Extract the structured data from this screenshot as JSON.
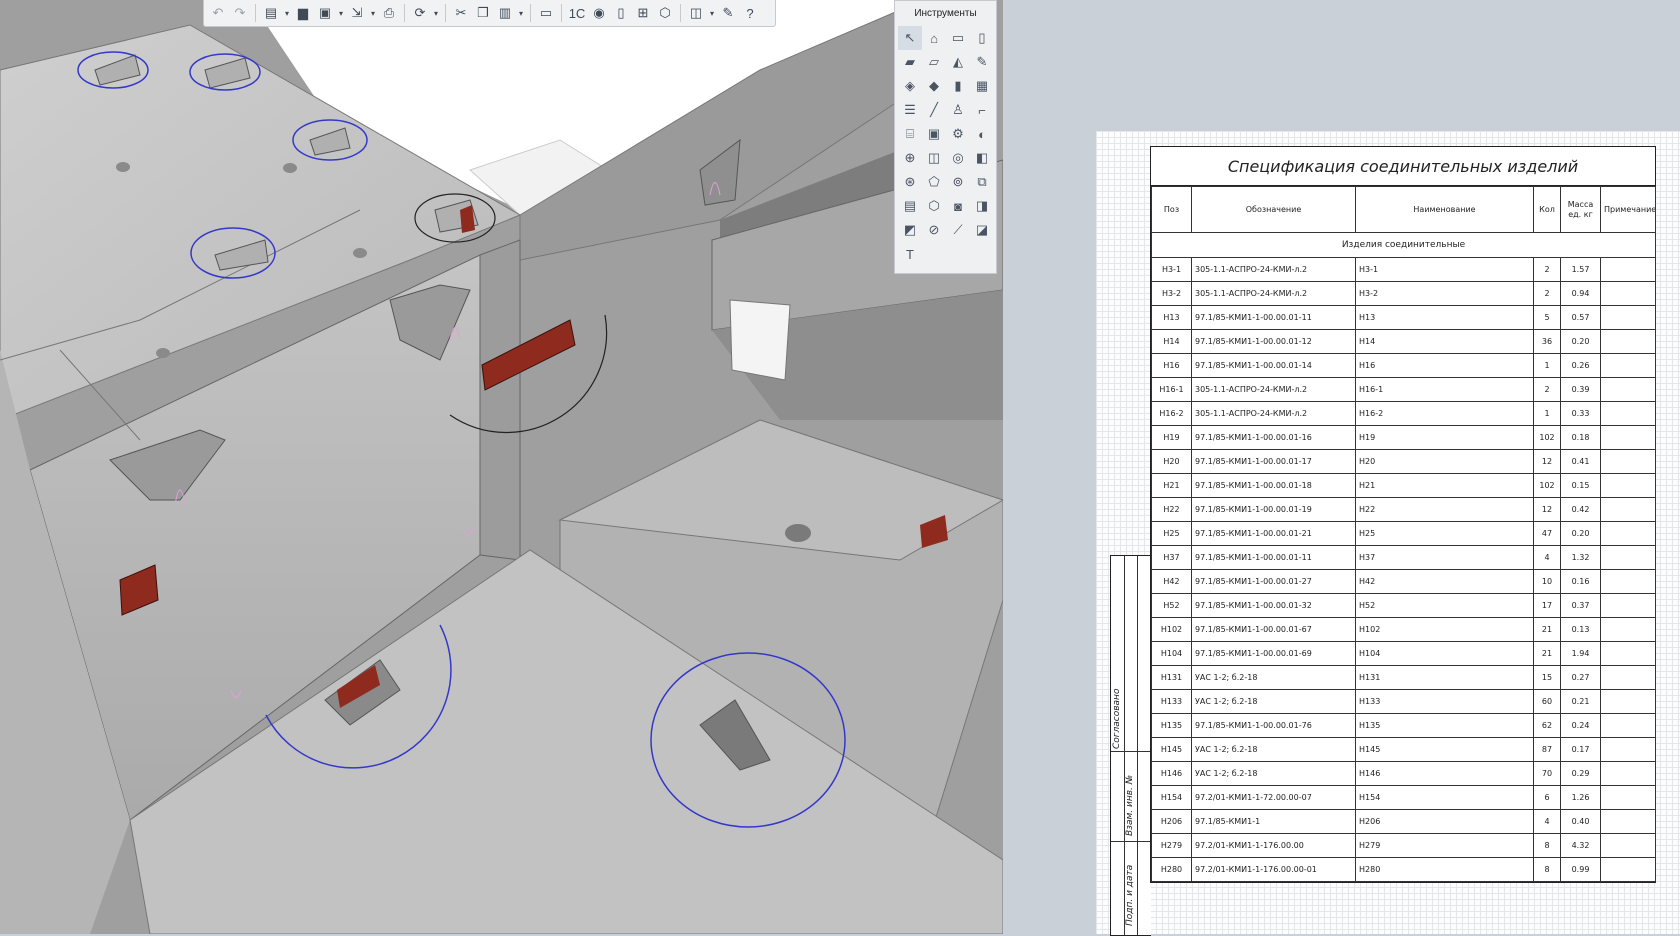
{
  "toolbar": {
    "items": [
      {
        "name": "undo-icon",
        "glyph": "↶",
        "dim": true
      },
      {
        "name": "redo-icon",
        "glyph": "↷",
        "dim": true
      },
      {
        "name": "new-document-icon",
        "glyph": "▤",
        "dd": true
      },
      {
        "name": "open-folder-icon",
        "glyph": "▆"
      },
      {
        "name": "save-icon",
        "glyph": "▣",
        "dd": true
      },
      {
        "name": "export-icon",
        "glyph": "⇲",
        "dd": true
      },
      {
        "name": "print-icon",
        "glyph": "⎙"
      },
      {
        "name": "view-rotate-icon",
        "glyph": "⟳",
        "dd": true
      },
      {
        "name": "cut-icon",
        "glyph": "✂"
      },
      {
        "name": "copy-icon",
        "glyph": "❐"
      },
      {
        "name": "paste-icon",
        "glyph": "▥",
        "dd": true
      },
      {
        "name": "format-brush-icon",
        "glyph": "▭"
      },
      {
        "name": "1c-icon",
        "glyph": "1С"
      },
      {
        "name": "render-icon",
        "glyph": "◉"
      },
      {
        "name": "properties-icon",
        "glyph": "▯"
      },
      {
        "name": "structure-tree-icon",
        "glyph": "⊞"
      },
      {
        "name": "model-3d-icon",
        "glyph": "⬡"
      },
      {
        "name": "layers-icon",
        "glyph": "◫",
        "dd": true
      },
      {
        "name": "settings-wrench-icon",
        "glyph": "✎"
      },
      {
        "name": "help-icon",
        "glyph": "?"
      }
    ]
  },
  "tools": {
    "title": "Инструменты",
    "items": [
      {
        "name": "select-arrow-icon",
        "glyph": "↖",
        "active": true
      },
      {
        "name": "wall-tool-icon",
        "glyph": "⌂"
      },
      {
        "name": "rectangle-tool-icon",
        "glyph": "▭"
      },
      {
        "name": "column-tool-icon",
        "glyph": "▯"
      },
      {
        "name": "slab-tool-icon",
        "glyph": "▰"
      },
      {
        "name": "beam-tool-icon",
        "glyph": "▱"
      },
      {
        "name": "roof-tool-icon",
        "glyph": "◭"
      },
      {
        "name": "pencil-tool-icon",
        "glyph": "✎"
      },
      {
        "name": "panel-tool-icon",
        "glyph": "◈"
      },
      {
        "name": "plate-tool-icon",
        "glyph": "◆"
      },
      {
        "name": "door-tool-icon",
        "glyph": "▮"
      },
      {
        "name": "window-tool-icon",
        "glyph": "▦"
      },
      {
        "name": "railing-tool-icon",
        "glyph": "☰"
      },
      {
        "name": "line-tool-icon",
        "glyph": "╱"
      },
      {
        "name": "fixture-tool-icon",
        "glyph": "♙"
      },
      {
        "name": "pipe-tool-icon",
        "glyph": "⌐"
      },
      {
        "name": "stair-tool-icon",
        "glyph": "⌸"
      },
      {
        "name": "opening-tool-icon",
        "glyph": "▣"
      },
      {
        "name": "equipment-tool-icon",
        "glyph": "⚙"
      },
      {
        "name": "duct-tool-icon",
        "glyph": "◐"
      },
      {
        "name": "mesh-tool-icon",
        "glyph": "⊕"
      },
      {
        "name": "room-tool-icon",
        "glyph": "◫"
      },
      {
        "name": "surface-tool-icon",
        "glyph": "◎"
      },
      {
        "name": "object-tool-icon",
        "glyph": "◧"
      },
      {
        "name": "assembly-tool-icon",
        "glyph": "⊛"
      },
      {
        "name": "shell-tool-icon",
        "glyph": "⬠"
      },
      {
        "name": "tank-tool-icon",
        "glyph": "⊚"
      },
      {
        "name": "cube-tool-icon",
        "glyph": "⧉"
      },
      {
        "name": "cabinet-tool-icon",
        "glyph": "▤"
      },
      {
        "name": "solid-tool-icon",
        "glyph": "⬡"
      },
      {
        "name": "camera-tool-icon",
        "glyph": "◙"
      },
      {
        "name": "zone-tool-icon",
        "glyph": "◨"
      },
      {
        "name": "detail-tool-icon",
        "glyph": "◩"
      },
      {
        "name": "section-tool-icon",
        "glyph": "⊘"
      },
      {
        "name": "dimension-tool-icon",
        "glyph": "⟋"
      },
      {
        "name": "hatch-tool-icon",
        "glyph": "◪"
      },
      {
        "name": "text-tool-icon",
        "glyph": "T"
      }
    ]
  },
  "spec": {
    "title": "Спецификация соединительных изделий",
    "headers": {
      "pos": "Поз",
      "designation": "Обозначение",
      "name": "Наименование",
      "qty": "Кол",
      "mass": "Масса ед. кг",
      "note": "Примечание"
    },
    "group": "Изделия соединительные",
    "rows": [
      [
        "Н3-1",
        "305-1.1-АСПРО-24-КМИ-л.2",
        "Н3-1",
        "2",
        "1.57",
        ""
      ],
      [
        "Н3-2",
        "305-1.1-АСПРО-24-КМИ-л.2",
        "Н3-2",
        "2",
        "0.94",
        ""
      ],
      [
        "Н13",
        "97.1/85-КМИ1-1-00.00.01-11",
        "Н13",
        "5",
        "0.57",
        ""
      ],
      [
        "Н14",
        "97.1/85-КМИ1-1-00.00.01-12",
        "Н14",
        "36",
        "0.20",
        ""
      ],
      [
        "Н16",
        "97.1/85-КМИ1-1-00.00.01-14",
        "Н16",
        "1",
        "0.26",
        ""
      ],
      [
        "Н16-1",
        "305-1.1-АСПРО-24-КМИ-л.2",
        "Н16-1",
        "2",
        "0.39",
        ""
      ],
      [
        "Н16-2",
        "305-1.1-АСПРО-24-КМИ-л.2",
        "Н16-2",
        "1",
        "0.33",
        ""
      ],
      [
        "Н19",
        "97.1/85-КМИ1-1-00.00.01-16",
        "Н19",
        "102",
        "0.18",
        ""
      ],
      [
        "Н20",
        "97.1/85-КМИ1-1-00.00.01-17",
        "Н20",
        "12",
        "0.41",
        ""
      ],
      [
        "Н21",
        "97.1/85-КМИ1-1-00.00.01-18",
        "Н21",
        "102",
        "0.15",
        ""
      ],
      [
        "Н22",
        "97.1/85-КМИ1-1-00.00.01-19",
        "Н22",
        "12",
        "0.42",
        ""
      ],
      [
        "Н25",
        "97.1/85-КМИ1-1-00.00.01-21",
        "Н25",
        "47",
        "0.20",
        ""
      ],
      [
        "Н37",
        "97.1/85-КМИ1-1-00.00.01-11",
        "Н37",
        "4",
        "1.32",
        ""
      ],
      [
        "Н42",
        "97.1/85-КМИ1-1-00.00.01-27",
        "Н42",
        "10",
        "0.16",
        ""
      ],
      [
        "Н52",
        "97.1/85-КМИ1-1-00.00.01-32",
        "Н52",
        "17",
        "0.37",
        ""
      ],
      [
        "Н102",
        "97.1/85-КМИ1-1-00.00.01-67",
        "Н102",
        "21",
        "0.13",
        ""
      ],
      [
        "Н104",
        "97.1/85-КМИ1-1-00.00.01-69",
        "Н104",
        "21",
        "1.94",
        ""
      ],
      [
        "Н131",
        "УАС 1-2; б.2-18",
        "Н131",
        "15",
        "0.27",
        ""
      ],
      [
        "Н133",
        "УАС 1-2; б.2-18",
        "Н133",
        "60",
        "0.21",
        ""
      ],
      [
        "Н135",
        "97.1/85-КМИ1-1-00.00.01-76",
        "Н135",
        "62",
        "0.24",
        ""
      ],
      [
        "Н145",
        "УАС 1-2; б.2-18",
        "Н145",
        "87",
        "0.17",
        ""
      ],
      [
        "Н146",
        "УАС 1-2; б.2-18",
        "Н146",
        "70",
        "0.29",
        ""
      ],
      [
        "Н154",
        "97.2/01-КМИ1-1-72.00.00-07",
        "Н154",
        "6",
        "1.26",
        ""
      ],
      [
        "Н206",
        "97.1/85-КМИ1-1",
        "Н206",
        "4",
        "0.40",
        ""
      ],
      [
        "Н279",
        "97.2/01-КМИ1-1-176.00.00",
        "Н279",
        "8",
        "4.32",
        ""
      ],
      [
        "Н280",
        "97.2/01-КМИ1-1-176.00.00-01",
        "Н280",
        "8",
        "0.99",
        ""
      ]
    ]
  },
  "stamp": {
    "agreed": "Согласовано",
    "inv": "Взам. инв. №",
    "sign": "Подп. и дата"
  },
  "colors": {
    "connector": "#8e2a1e",
    "marker_circle": "#3438c8",
    "sheet_grid": "#e4e7ea"
  }
}
